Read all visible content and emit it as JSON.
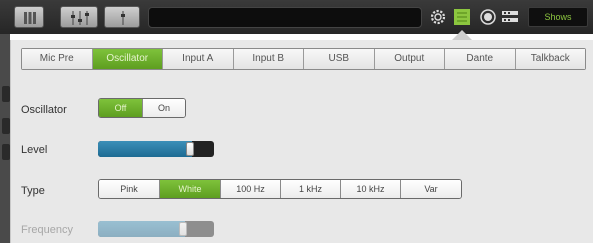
{
  "toolbar": {
    "buttons": [
      "mixer-grid-icon",
      "faders-icon",
      "single-fader-icon"
    ],
    "right_icons": [
      "gear-icon",
      "channel-setup-icon",
      "record-icon",
      "io-icon"
    ],
    "shows_label": "Shows",
    "accent": "#8cc63f"
  },
  "tabs": [
    {
      "label": "Mic Pre",
      "active": false
    },
    {
      "label": "Oscillator",
      "active": true
    },
    {
      "label": "Input A",
      "active": false
    },
    {
      "label": "Input B",
      "active": false
    },
    {
      "label": "USB",
      "active": false
    },
    {
      "label": "Output",
      "active": false
    },
    {
      "label": "Dante",
      "active": false
    },
    {
      "label": "Talkback",
      "active": false
    }
  ],
  "oscillator": {
    "label": "Oscillator",
    "options": [
      {
        "label": "Off",
        "active": true
      },
      {
        "label": "On",
        "active": false
      }
    ]
  },
  "level": {
    "label": "Level",
    "value_fraction": 0.81
  },
  "type": {
    "label": "Type",
    "options": [
      {
        "label": "Pink",
        "active": false
      },
      {
        "label": "White",
        "active": true
      },
      {
        "label": "100 Hz",
        "active": false
      },
      {
        "label": "1 kHz",
        "active": false
      },
      {
        "label": "10 kHz",
        "active": false
      },
      {
        "label": "Var",
        "active": false
      }
    ]
  },
  "frequency": {
    "label": "Frequency",
    "value_fraction": 0.75,
    "enabled": false
  }
}
